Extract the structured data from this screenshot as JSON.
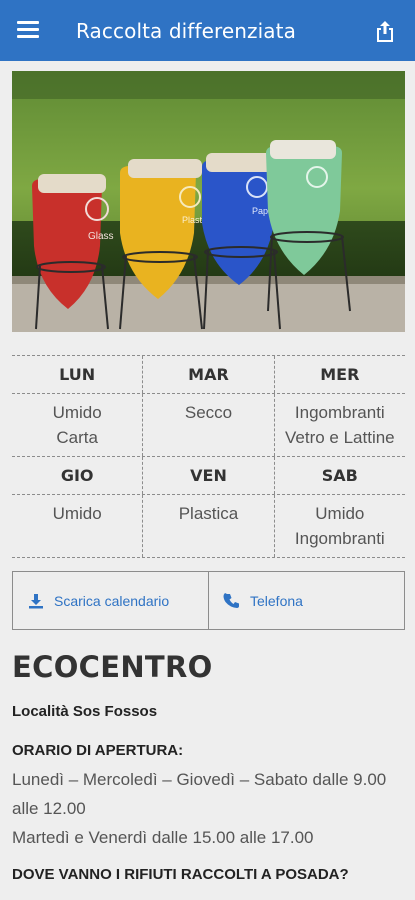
{
  "appbar": {
    "title": "Raccolta differenziata",
    "menu_icon": "hamburger-menu-icon",
    "share_icon": "share-icon"
  },
  "hero": {
    "bins": [
      {
        "label": "Glass",
        "color": "#c8302b"
      },
      {
        "label": "Plastic",
        "color": "#e9b320"
      },
      {
        "label": "Paper",
        "color": "#2a55c9"
      },
      {
        "label": "",
        "color": "#7fc99a"
      }
    ]
  },
  "schedule": {
    "row1": {
      "days": [
        "LUN",
        "MAR",
        "MER"
      ],
      "items": [
        [
          "Umido",
          "Carta"
        ],
        [
          "Secco"
        ],
        [
          "Ingombranti",
          "Vetro e Lattine"
        ]
      ]
    },
    "row2": {
      "days": [
        "GIO",
        "VEN",
        "SAB"
      ],
      "items": [
        [
          "Umido"
        ],
        [
          "Plastica"
        ],
        [
          "Umido",
          "Ingombranti"
        ]
      ]
    }
  },
  "actions": {
    "download_label": "Scarica calendario",
    "download_icon": "download-icon",
    "phone_label": "Telefona",
    "phone_icon": "phone-icon"
  },
  "ecocentro": {
    "title": "ECOCENTRO",
    "location": "Località Sos Fossos",
    "hours_label": "ORARIO DI APERTURA:",
    "hours_line1": "Lunedì – Mercoledì – Giovedì – Sabato dalle 9.00 alle 12.00",
    "hours_line2": "Martedì e Venerdì dalle 15.00 alle 17.00",
    "question": "DOVE VANNO I RIFIUTI RACCOLTI A POSADA?"
  },
  "colors": {
    "primary": "#2f73c4",
    "background": "#eeeeee"
  }
}
